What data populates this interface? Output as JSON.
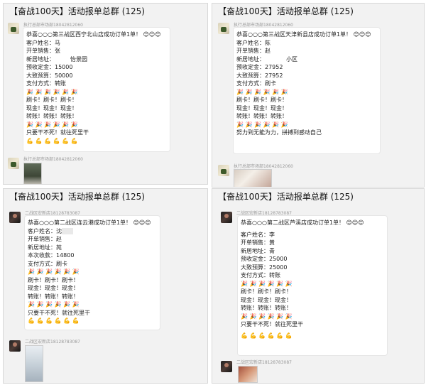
{
  "panels": [
    {
      "title": "【奋战100天】活动报单总群 (125)",
      "sender_top": "执行总部市场部18042812060",
      "congrats": "恭喜○○○第三战区西宁北山店成功订单1单！",
      "fields": [
        "客户姓名：马",
        "开单销售：张",
        "新居地址：",
        "预收定金：15000",
        "大致预算：50000",
        "支付方式：转账"
      ],
      "address_tail": "怡景园",
      "chants": [
        "刷卡！刷卡！刷卡！",
        "现金！现金！现金！",
        "转账！转账！转账！"
      ],
      "slogan": "只要干不死！就往死里干",
      "sender_bottom": "执行总部市场部18042812060"
    },
    {
      "title": "【奋战100天】活动报单总群 (125)",
      "sender_top": "执行总部市场部18042812060",
      "congrats": "恭喜○○○第三战区天津新县店成功订单1单！",
      "fields": [
        "客户姓名：陈",
        "开单销售：赵",
        "新居地址：",
        "预收定金：27952",
        "大致预算：27952",
        "支付方式：刷卡"
      ],
      "address_tail": "小区",
      "chants": [
        "刷卡！刷卡！刷卡！",
        "现金！现金！现金！",
        "转账！转账！转账！"
      ],
      "slogan": "努力到无能为力，拼搏到感动自己",
      "sender_bottom": "执行总部市场部18042812060"
    },
    {
      "title": "【奋战100天】活动报单总群 (125)",
      "sender_top": "二战区宏新店18128783087",
      "congrats": "恭喜○○○第二战区连云港成功订单1单！",
      "fields": [
        "客户姓名：沈",
        "开单销售：赵",
        "新居地址：苑",
        "本次收款：14800",
        "支付方式：刷卡"
      ],
      "chants": [
        "刷卡！刷卡！刷卡！",
        "现金！现金！现金！",
        "转账！转账！转账！"
      ],
      "slogan": "只要干不死！就往死里干",
      "sender_bottom": "二战区宏新店18128783087"
    },
    {
      "title": "【奋战100天】活动报单总群 (125)",
      "sender_top": "二战区宏新店18128783087",
      "congrats": "恭喜○○○第二战区芦溪店成功订单1单！",
      "fields": [
        "客户姓名：李",
        "开单销售：黄",
        "新居地址：青",
        "预收定金：25000",
        "大致预算：25000",
        "支付方式：转账"
      ],
      "chants": [
        "刷卡！刷卡！刷卡！",
        "现金！现金！现金！",
        "转账！转账！转账！"
      ],
      "slogan": "只要干不死！就往死里干",
      "sender_bottom": "二战区宏新店18128783087"
    }
  ],
  "emoji": {
    "smile": "😊",
    "party": "🎉",
    "muscle": "💪"
  }
}
